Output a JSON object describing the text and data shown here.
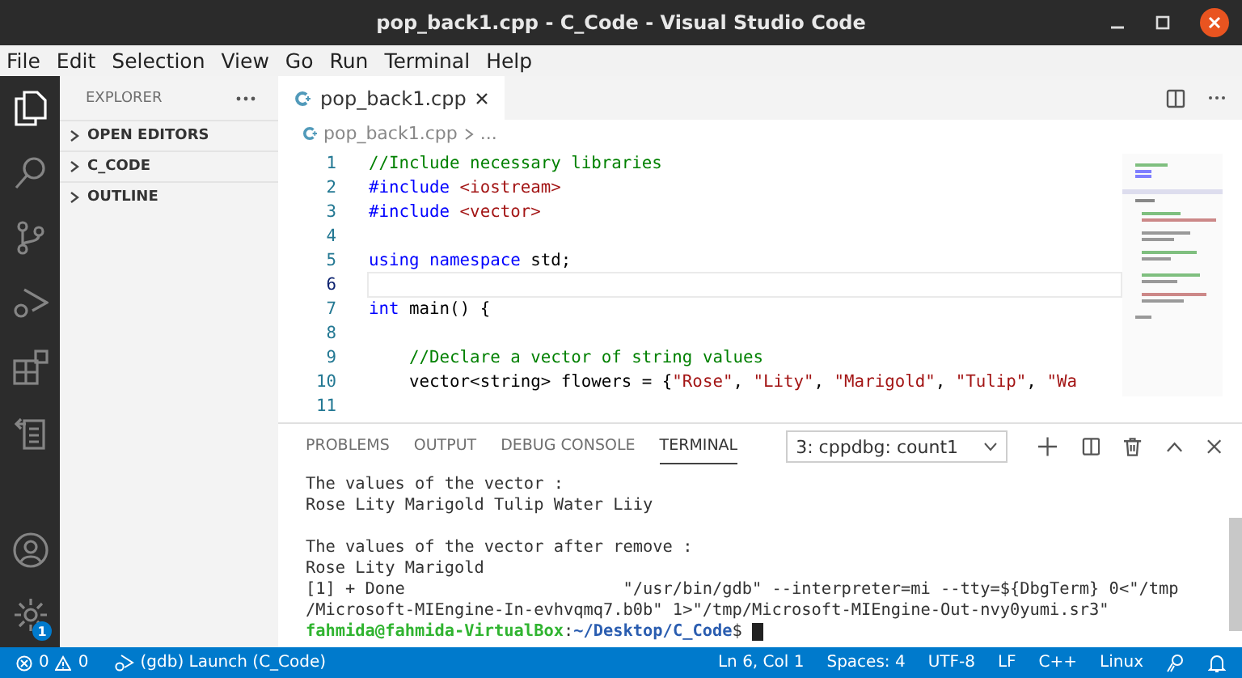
{
  "window": {
    "title": "pop_back1.cpp - C_Code - Visual Studio Code"
  },
  "menu": [
    "File",
    "Edit",
    "Selection",
    "View",
    "Go",
    "Run",
    "Terminal",
    "Help"
  ],
  "activity_bar": {
    "items": [
      {
        "kind": "files",
        "selected": true
      },
      {
        "kind": "search",
        "selected": false
      },
      {
        "kind": "source-control",
        "selected": false
      },
      {
        "kind": "run",
        "selected": false
      },
      {
        "kind": "extensions",
        "selected": false
      },
      {
        "kind": "remote",
        "selected": false
      }
    ],
    "settings_badge": "1"
  },
  "sidebar": {
    "title": "EXPLORER",
    "sections": [
      {
        "label": "OPEN EDITORS",
        "expanded": false
      },
      {
        "label": "C_CODE",
        "expanded": false
      },
      {
        "label": "OUTLINE",
        "expanded": false
      }
    ]
  },
  "editor": {
    "tabs": [
      {
        "label": "pop_back1.cpp",
        "selected": true
      }
    ],
    "breadcrumb": [
      "pop_back1.cpp",
      "..."
    ],
    "lines": [
      {
        "number": "1",
        "current": false,
        "tokens": [
          {
            "kind": "comment",
            "text": "//Include necessary libraries"
          }
        ]
      },
      {
        "number": "2",
        "current": false,
        "tokens": [
          {
            "kind": "keyword",
            "text": "#include"
          },
          {
            "kind": "string",
            "text": " <iostream>"
          }
        ]
      },
      {
        "number": "3",
        "current": false,
        "tokens": [
          {
            "kind": "keyword",
            "text": "#include"
          },
          {
            "kind": "string",
            "text": " <vector>"
          }
        ]
      },
      {
        "number": "4",
        "current": false
      },
      {
        "number": "5",
        "current": false,
        "tokens": [
          {
            "kind": "keyword",
            "text": "using"
          },
          {
            "kind": "keyword",
            "text": " namespace"
          },
          {
            "kind": "text",
            "text": " std;"
          }
        ]
      },
      {
        "number": "6",
        "current": true
      },
      {
        "number": "7",
        "current": false,
        "tokens": [
          {
            "kind": "keyword",
            "text": "int"
          },
          {
            "kind": "text",
            "text": " main() {"
          }
        ]
      },
      {
        "number": "8",
        "current": false
      },
      {
        "number": "9",
        "current": false,
        "tokens": [
          {
            "kind": "comment",
            "text": "    //Declare a vector of string values"
          }
        ]
      },
      {
        "number": "10",
        "current": false,
        "tokens": [
          {
            "kind": "text",
            "text": "    vector<string> flowers = {"
          },
          {
            "kind": "string",
            "text": "\"Rose\""
          },
          {
            "kind": "text",
            "text": ", "
          },
          {
            "kind": "string",
            "text": "\"Lity\""
          },
          {
            "kind": "text",
            "text": ", "
          },
          {
            "kind": "string",
            "text": "\"Marigold\""
          },
          {
            "kind": "text",
            "text": ", "
          },
          {
            "kind": "string",
            "text": "\"Tulip\""
          },
          {
            "kind": "text",
            "text": ", "
          },
          {
            "kind": "string",
            "text": "\"Wa"
          }
        ]
      },
      {
        "number": "11",
        "current": false
      }
    ]
  },
  "panel": {
    "tabs": [
      {
        "label": "PROBLEMS",
        "selected": false
      },
      {
        "label": "OUTPUT",
        "selected": false
      },
      {
        "label": "DEBUG CONSOLE",
        "selected": false
      },
      {
        "label": "TERMINAL",
        "selected": true
      }
    ],
    "terminal_select": "3: cppdbg: count1",
    "terminal_lines": [
      {
        "kind": "output",
        "text": "The values of the vector :"
      },
      {
        "kind": "output",
        "text": "Rose Lity Marigold Tulip Water Liiy"
      },
      {
        "kind": "blank"
      },
      {
        "kind": "output",
        "text": "The values of the vector after remove :"
      },
      {
        "kind": "output",
        "text": "Rose Lity Marigold"
      },
      {
        "kind": "output",
        "text": "[1] + Done                      \"/usr/bin/gdb\" --interpreter=mi --tty=${DbgTerm} 0<\"/tmp"
      },
      {
        "kind": "output",
        "text": "/Microsoft-MIEngine-In-evhvqmq7.b0b\" 1>\"/tmp/Microsoft-MIEngine-Out-nvy0yumi.sr3\""
      },
      {
        "kind": "prompt",
        "user": "fahmida@fahmida-VirtualBox",
        "separator": ":",
        "path": "~/Desktop/C_Code",
        "symbol": "$"
      }
    ]
  },
  "status_bar": {
    "errors": "0",
    "warnings": "0",
    "launch": "(gdb) Launch (C_Code)",
    "right": [
      "Ln 6, Col 1",
      "Spaces: 4",
      "UTF-8",
      "LF",
      "C++",
      "Linux"
    ]
  }
}
